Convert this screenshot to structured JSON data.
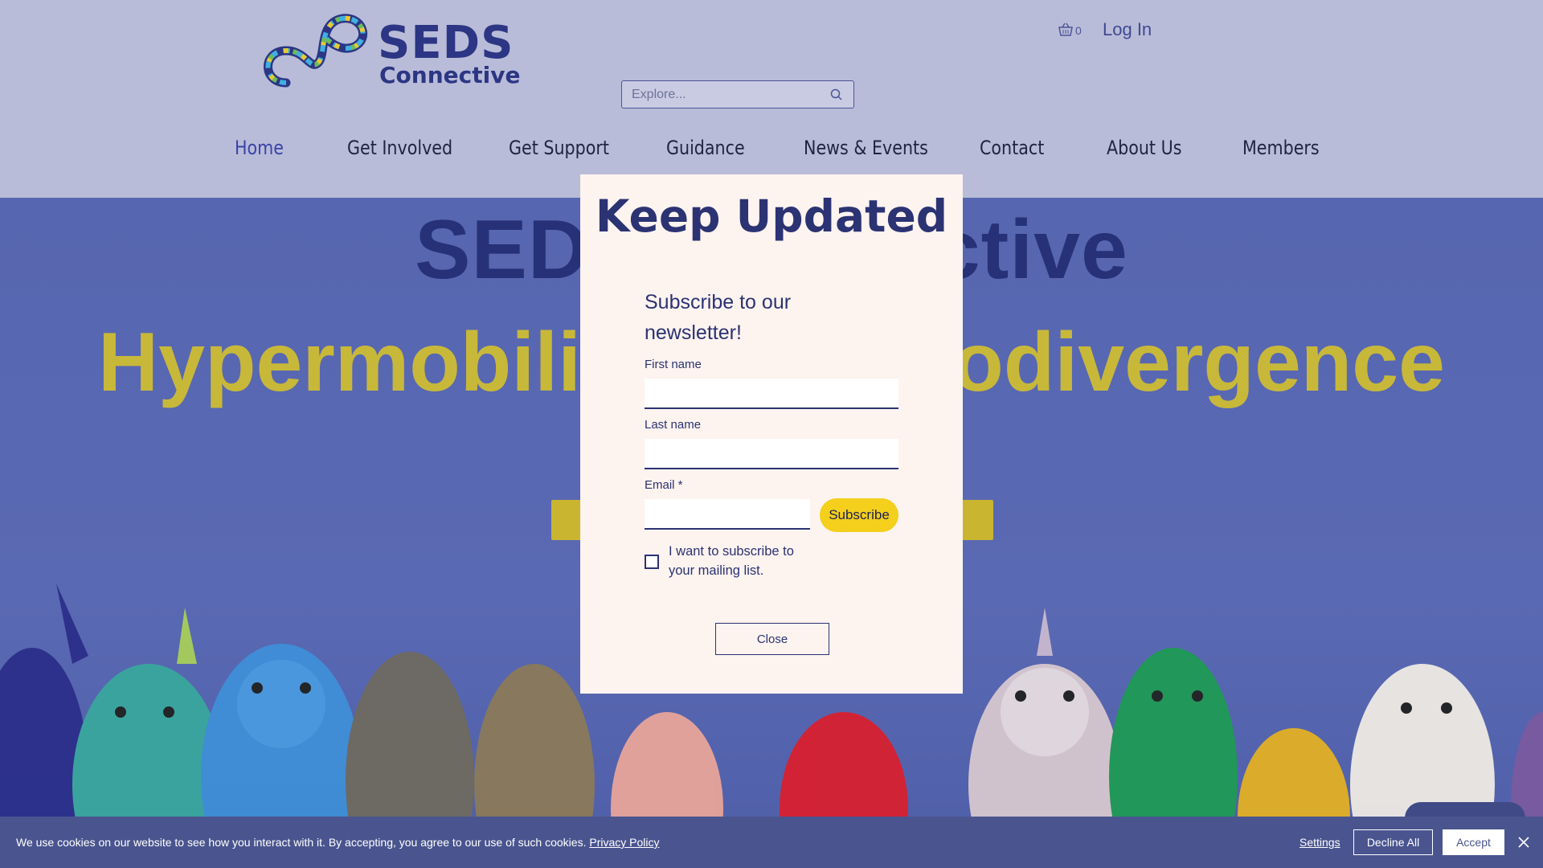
{
  "header": {
    "logo": {
      "line1": "SEDS",
      "line2": "Connective"
    },
    "cart": {
      "count": "0",
      "icon": "basket-icon"
    },
    "login_label": "Log In",
    "search": {
      "placeholder": "Explore...",
      "value": "",
      "icon": "search-icon"
    },
    "nav": [
      {
        "label": "Home",
        "active": true
      },
      {
        "label": "Get Involved",
        "active": false
      },
      {
        "label": "Get Support",
        "active": false
      },
      {
        "label": "Guidance",
        "active": false
      },
      {
        "label": "News & Events",
        "active": false
      },
      {
        "label": "Contact",
        "active": false
      },
      {
        "label": "About Us",
        "active": false
      },
      {
        "label": "Members",
        "active": false
      }
    ]
  },
  "hero": {
    "title": "SEDS Connective",
    "subtitle": "Hypermobility & Neurodivergence"
  },
  "modal": {
    "title": "Keep Updated",
    "subtitle": "Subscribe to our newsletter!",
    "fields": {
      "first_name_label": "First name",
      "first_name_value": "",
      "last_name_label": "Last name",
      "last_name_value": "",
      "email_label": "Email *",
      "email_value": ""
    },
    "subscribe_label": "Subscribe",
    "checkbox_label": "I want to subscribe to your mailing list.",
    "checkbox_checked": false,
    "close_label": "Close"
  },
  "cookie_bar": {
    "text": "We use cookies on our website to see how you interact with it. By accepting, you agree to our use of such cookies.",
    "policy_link": "Privacy Policy",
    "settings_label": "Settings",
    "decline_label": "Decline All",
    "accept_label": "Accept",
    "close_icon": "close-icon"
  },
  "colors": {
    "header_bg": "#b9bcd8",
    "hero_bg": "#5766b0",
    "brand_navy": "#2b3373",
    "accent_yellow": "#f4cf1c",
    "modal_bg": "#fdf3ef",
    "cookie_bg": "#4a558f"
  }
}
